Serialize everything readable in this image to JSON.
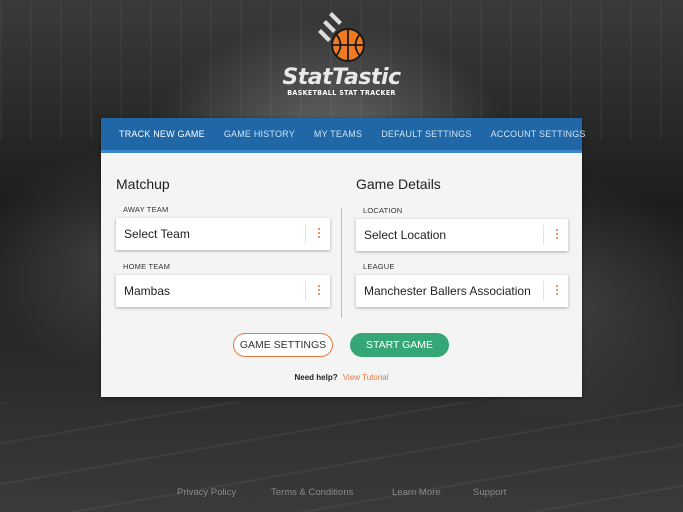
{
  "brand": {
    "name": "StatTastic",
    "tagline": "BASKETBALL STAT TRACKER"
  },
  "nav": {
    "tabs": [
      {
        "label": "TRACK NEW GAME",
        "active": true
      },
      {
        "label": "GAME HISTORY"
      },
      {
        "label": "MY TEAMS"
      },
      {
        "label": "DEFAULT SETTINGS"
      },
      {
        "label": "ACCOUNT SETTINGS"
      }
    ]
  },
  "matchup": {
    "title": "Matchup",
    "away_label": "AWAY TEAM",
    "away_value": "Select Team",
    "home_label": "HOME TEAM",
    "home_value": "Mambas"
  },
  "details": {
    "title": "Game Details",
    "location_label": "LOCATION",
    "location_value": "Select Location",
    "league_label": "LEAGUE",
    "league_value": "Manchester Ballers Association"
  },
  "actions": {
    "settings_label": "GAME SETTINGS",
    "start_label": "START GAME"
  },
  "help": {
    "question": "Need help?",
    "link": "View Tutorial"
  },
  "footer": {
    "links": [
      "Privacy Policy",
      "Terms & Conditions",
      "Learn More",
      "Support"
    ]
  },
  "colors": {
    "nav_blue": "#1f67a6",
    "accent_orange": "#e8783a",
    "start_green": "#35a676"
  },
  "icons": {
    "logo": "basketball-icon",
    "field_menu": "kebab-menu-icon"
  }
}
